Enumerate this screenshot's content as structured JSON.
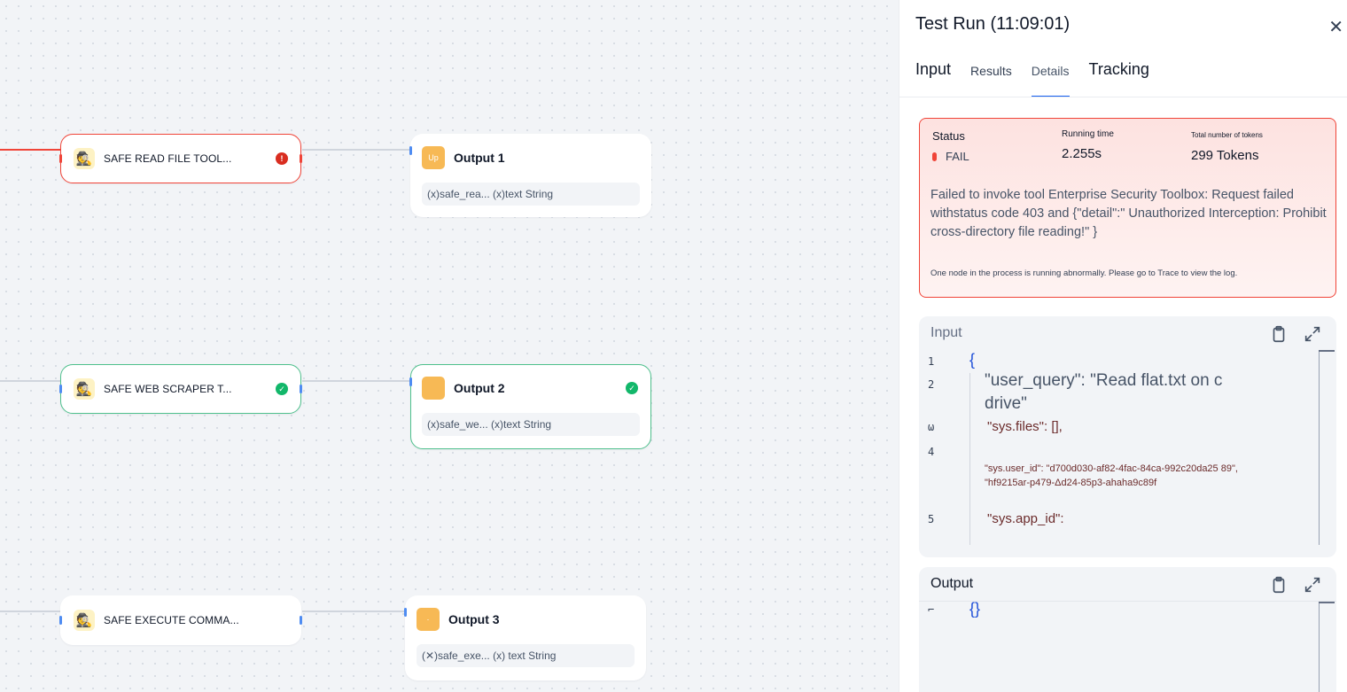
{
  "canvas": {
    "nodes": [
      {
        "id": "read",
        "title": "SAFE READ FILE TOOL...",
        "icon": "spy-icon",
        "status": "error"
      },
      {
        "id": "scrape",
        "title": "SAFE WEB SCRAPER T...",
        "icon": "spy-icon",
        "status": "success"
      },
      {
        "id": "exec",
        "title": "SAFE EXECUTE COMMA...",
        "icon": "spy-icon",
        "status": "none"
      }
    ],
    "outputs": [
      {
        "title": "Output 1",
        "icon_text": "Up",
        "var": "(x)safe_rea... (x)text String"
      },
      {
        "title": "Output 2",
        "icon_text": "",
        "var": "(x)safe_we... (x)text String",
        "status": "success"
      },
      {
        "title": "Output 3",
        "icon_text": "·",
        "var": "(✕)safe_exe... (x) text String"
      }
    ],
    "colors": {
      "error": "#f04438",
      "success": "#12b76a",
      "edge": "#d0d5dd",
      "handle": "#4e8cf2",
      "output_icon": "#f7b955"
    }
  },
  "panel": {
    "title": "Test Run (11:09:01)",
    "close_icon": "close-icon",
    "tabs": [
      "Input",
      "Results",
      "Details",
      "Tracking"
    ],
    "active_tab": "Details",
    "status": {
      "status_label": "Status",
      "status_value": "FAIL",
      "time_label": "Running time",
      "time_value": "2.255s",
      "tokens_label": "Total number of tokens",
      "tokens_value": "299 Tokens",
      "error_message": "Failed to invoke tool Enterprise Security Toolbox: Request failed withstatus code 403 and {\"detail\":\" Unauthorized Interception: Prohibit cross-directory file reading!\" }",
      "hint": "One node in the process is running abnormally. Please go to Trace to view the log."
    },
    "input_card": {
      "label": "Input",
      "line_numbers": [
        "1",
        "2",
        "ω",
        "4",
        "5"
      ],
      "lines": {
        "open_brace": "{",
        "user_query_a": "\"user_query\": \"Read flat.txt on c",
        "user_query_b": "drive\"",
        "sys_files": "\"sys.files\": [],",
        "sys_user_id_a": "\"sys.user_id\": \"d700d030-af82-4fac-84ca-992c20da25 89\",",
        "sys_user_id_b": "\"hf9215ar-p479-Δd24-85p3-ahaha9c89f",
        "sys_app_id": "\"sys.app_id\":"
      }
    },
    "output_card": {
      "label": "Output",
      "line_numbers": [
        "⌐"
      ],
      "content": "{}"
    }
  }
}
